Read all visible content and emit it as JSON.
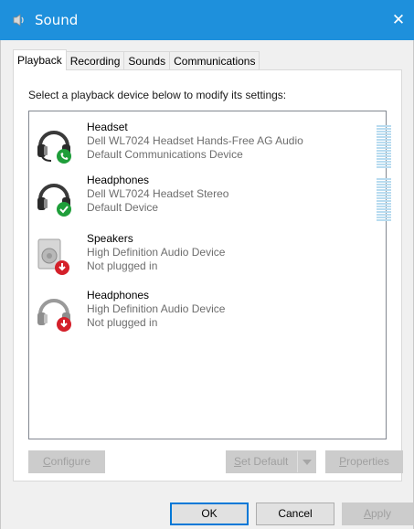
{
  "window": {
    "title": "Sound",
    "close_glyph": "✕"
  },
  "tabs": [
    {
      "label": "Playback",
      "active": true
    },
    {
      "label": "Recording"
    },
    {
      "label": "Sounds"
    },
    {
      "label": "Communications"
    }
  ],
  "instruction": "Select a playback device below to modify its settings:",
  "devices": [
    {
      "name": "Headset",
      "model": "Dell WL7024 Headset Hands-Free AG Audio",
      "status": "Default Communications Device",
      "icon": "headset-icon",
      "badge": "phone-badge-icon",
      "level_bars": true
    },
    {
      "name": "Headphones",
      "model": "Dell WL7024 Headset Stereo",
      "status": "Default Device",
      "icon": "headphones-icon",
      "badge": "checkmark-badge-icon",
      "level_bars": true
    },
    {
      "name": "Speakers",
      "model": "High Definition Audio Device",
      "status": "Not plugged in",
      "icon": "speaker-icon",
      "badge": "unplugged-badge-icon",
      "level_bars": false
    },
    {
      "name": "Headphones",
      "model": "High Definition Audio Device",
      "status": "Not plugged in",
      "icon": "headphones-icon",
      "badge": "unplugged-badge-icon",
      "level_bars": false
    }
  ],
  "buttons": {
    "configure": {
      "label_u": "C",
      "label_rest": "onfigure"
    },
    "set_default": {
      "label_u": "S",
      "label_rest": "et Default"
    },
    "properties": {
      "label_u": "P",
      "label_rest": "roperties"
    },
    "ok": "OK",
    "cancel": "Cancel",
    "apply": {
      "label_u": "A",
      "label_rest": "pply"
    }
  },
  "colors": {
    "titlebar": "#1e90dc",
    "green_badge": "#1f9e3a",
    "red_badge": "#d4202a",
    "level_meter": "#b9dcf0"
  }
}
